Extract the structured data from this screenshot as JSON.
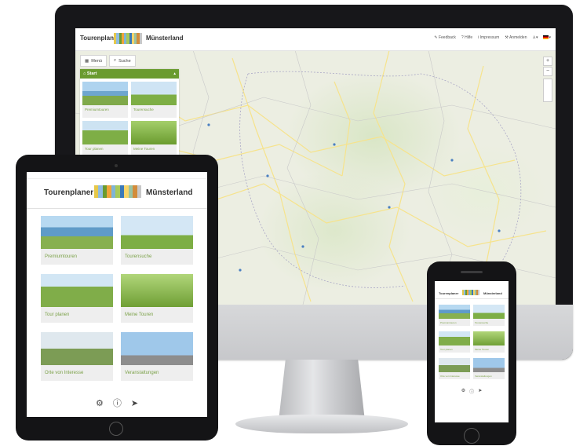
{
  "brand": {
    "name": "Tourenplaner",
    "region": "Münsterland",
    "stripe_colors": [
      "#e6c84a",
      "#8fbce0",
      "#6a9b2f",
      "#f0a43a",
      "#7fb4d6",
      "#a8c95a",
      "#3b79b8",
      "#f6d46a",
      "#9ac3a2",
      "#d28c3b",
      "#c8c8c8"
    ]
  },
  "desktop": {
    "nav": [
      {
        "icon": "feedback-icon",
        "label": "Feedback"
      },
      {
        "icon": "help-icon",
        "label": "Hilfe"
      },
      {
        "icon": "info-icon",
        "label": "Impressum"
      },
      {
        "icon": "wrench-icon",
        "label": "Anmelden"
      },
      {
        "icon": "person-icon",
        "label": ""
      },
      {
        "icon": "flag-de-icon",
        "label": ""
      }
    ],
    "tabs": [
      {
        "icon": "grid-icon",
        "label": "Menü"
      },
      {
        "icon": "search-icon",
        "label": "Suche"
      }
    ],
    "panel_title": "Start",
    "tiles": [
      "Premiumtouren",
      "Tourensuche",
      "Tour planen",
      "Meine Touren"
    ],
    "map_controls": [
      "+",
      "−"
    ]
  },
  "tablet": {
    "tiles": [
      "Premiumtouren",
      "Tourensuche",
      "Tour planen",
      "Meine Touren",
      "Orte von Interesse",
      "Veranstaltungen"
    ],
    "footer_icons": [
      "gear-icon",
      "info-icon",
      "send-icon"
    ]
  },
  "phone": {
    "tiles": [
      "Premiumtouren",
      "Tourensuche",
      "Tour planen",
      "Meine Touren",
      "Orte von Interesse",
      "Veranstaltungen"
    ],
    "footer_icons": [
      "gear-icon",
      "info-icon",
      "send-icon"
    ]
  },
  "colors": {
    "accent_green": "#6a9b2f",
    "label_green": "#7ba148",
    "device_black": "#141416"
  }
}
